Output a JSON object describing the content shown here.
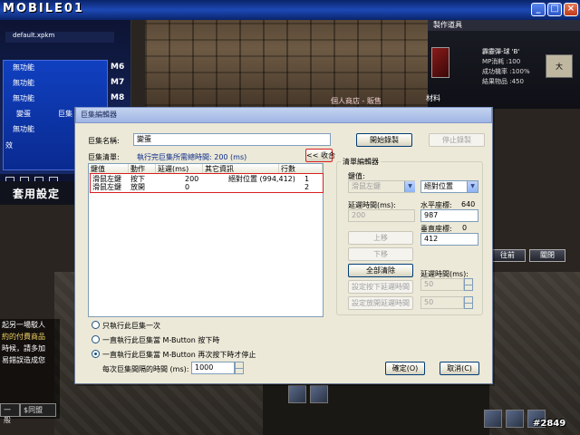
{
  "game": {
    "logo": "MOBILE01",
    "left_panel": {
      "filename": "default.xpkm",
      "items": [
        "無功能",
        "無功能",
        "無功能",
        "變蛋",
        "無功能"
      ],
      "partial_item": "巨集",
      "partial_item2": "效",
      "mkeys": [
        "M6",
        "M7",
        "M8"
      ],
      "banner": "套用設定"
    },
    "chat": {
      "lines": [
        "起另一場駁人",
        "約的付費商品",
        "",
        "時候，請多加",
        "易錯誤造成您"
      ],
      "tabs": [
        "一般",
        "$同盟"
      ]
    },
    "right_panel": {
      "header": "製作道具",
      "item_name": "霹靂彈-球 'B'",
      "stats": [
        "MP消耗 :100",
        "成功機率 :100%",
        "結果物品 :450"
      ],
      "tag": "大"
    },
    "right_label": "材料",
    "shop_label": "個人商店 - 販售",
    "buttons": {
      "list": "往前",
      "cancel": "關閉"
    },
    "watermark": "#2849"
  },
  "dialog": {
    "title": "巨集編輯器",
    "macro_name_label": "巨集名稱:",
    "macro_name_value": "變蛋",
    "record_start": "開始錄製",
    "record_stop": "停止錄製",
    "list_label": "巨集清單:",
    "exec_time_label": "執行完巨集所需總時間: 200 (ms)",
    "collapse_btn": "<< 收合",
    "columns": [
      "鍵值",
      "動作",
      "延遲(ms)",
      "其它資訊",
      "行數"
    ],
    "rows": [
      [
        "滑鼠左鍵",
        "按下",
        "200",
        "絕對位置 (994,412)",
        "1"
      ],
      [
        "滑鼠左鍵",
        "放開",
        "0",
        "",
        "2"
      ]
    ],
    "editor": {
      "title": "清單編輯器",
      "key_label": "鍵值:",
      "key_value": "滑鼠左鍵",
      "mode_value": "絕對位置",
      "delay_label": "延遲時間(ms):",
      "delay_value": "200",
      "hpos_label": "水平座標:",
      "hpos_value": "640",
      "vpos_label": "垂直座標:",
      "vpos_value": "0",
      "vpos_input": "412",
      "delay_input": "987",
      "btn_up": "上移",
      "btn_down": "下移",
      "btn_clear": "全部清除",
      "btn_set_press": "設定按下延遲時間",
      "btn_set_release": "設定放開延遲時間",
      "delay2_label": "延遲時間(ms):",
      "delay2_a": "50",
      "delay2_b": "50"
    },
    "options": [
      "只執行此巨集一次",
      "一直執行此巨集當 M-Button 按下時",
      "一直執行此巨集當 M-Button 再次按下時才停止"
    ],
    "selected_option": 2,
    "interval_label": "每次巨集間隔的時間 (ms):",
    "interval_value": "1000",
    "ok": "確定(O)",
    "cancel": "取消(C)"
  }
}
